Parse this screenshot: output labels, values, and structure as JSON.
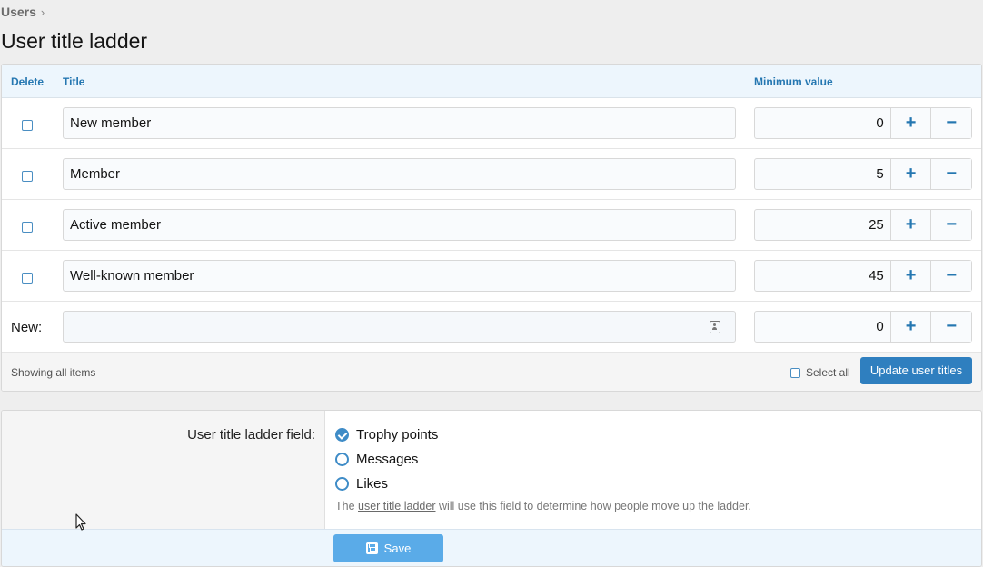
{
  "breadcrumb": {
    "parent": "Users",
    "chevron": "›"
  },
  "page_title": "User title ladder",
  "ladder": {
    "columns": {
      "delete": "Delete",
      "title": "Title",
      "minimum_value": "Minimum value"
    },
    "rows": [
      {
        "title": "New member",
        "value": "0"
      },
      {
        "title": "Member",
        "value": "5"
      },
      {
        "title": "Active member",
        "value": "25"
      },
      {
        "title": "Well-known member",
        "value": "45"
      }
    ],
    "new_row": {
      "label": "New:",
      "title": "",
      "value": "0"
    },
    "plus": "+",
    "minus": "−",
    "footer": {
      "showing": "Showing all items",
      "select_all": "Select all",
      "update_button": "Update user titles"
    }
  },
  "options": {
    "label": "User title ladder field:",
    "radios": [
      {
        "label": "Trophy points",
        "checked": true
      },
      {
        "label": "Messages",
        "checked": false
      },
      {
        "label": "Likes",
        "checked": false
      }
    ],
    "hint_prefix": "The ",
    "hint_link": "user title ladder",
    "hint_suffix": " will use this field to determine how people move up the ladder.",
    "save_button": "Save"
  },
  "colors": {
    "accent": "#2577b1",
    "header_bg": "#edf6fd",
    "save_button": "#5aabe8",
    "update_button": "#2f7fbf"
  }
}
